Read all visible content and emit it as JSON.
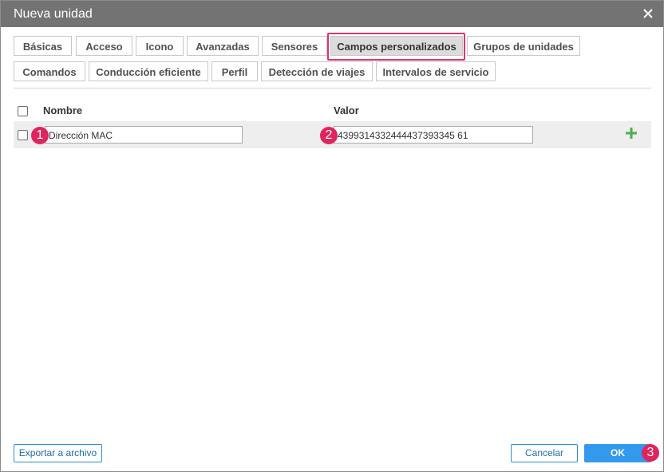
{
  "dialog": {
    "title": "Nueva unidad"
  },
  "tabs": {
    "row1": [
      "Básicas",
      "Acceso",
      "Icono",
      "Avanzadas",
      "Sensores",
      "Campos personalizados",
      "Grupos de unidades"
    ],
    "row2": [
      "Comandos",
      "Conducción eficiente",
      "Perfil",
      "Detección de viajes",
      "Intervalos de servicio"
    ],
    "active": "Campos personalizados"
  },
  "table": {
    "col_name": "Nombre",
    "col_value": "Valor",
    "rows": [
      {
        "name": "Dirección MAC",
        "value": "4399314332444437393345 61"
      }
    ]
  },
  "badges": [
    "1",
    "2",
    "3"
  ],
  "footer": {
    "export_label": "Exportar a archivo",
    "cancel_label": "Cancelar",
    "ok_label": "OK"
  },
  "colors": {
    "accent": "#3399ee",
    "highlight": "#e0336f",
    "add": "#4caf50",
    "titlebar": "#737373"
  },
  "icons": {
    "close": "close-icon",
    "add": "plus-icon"
  }
}
